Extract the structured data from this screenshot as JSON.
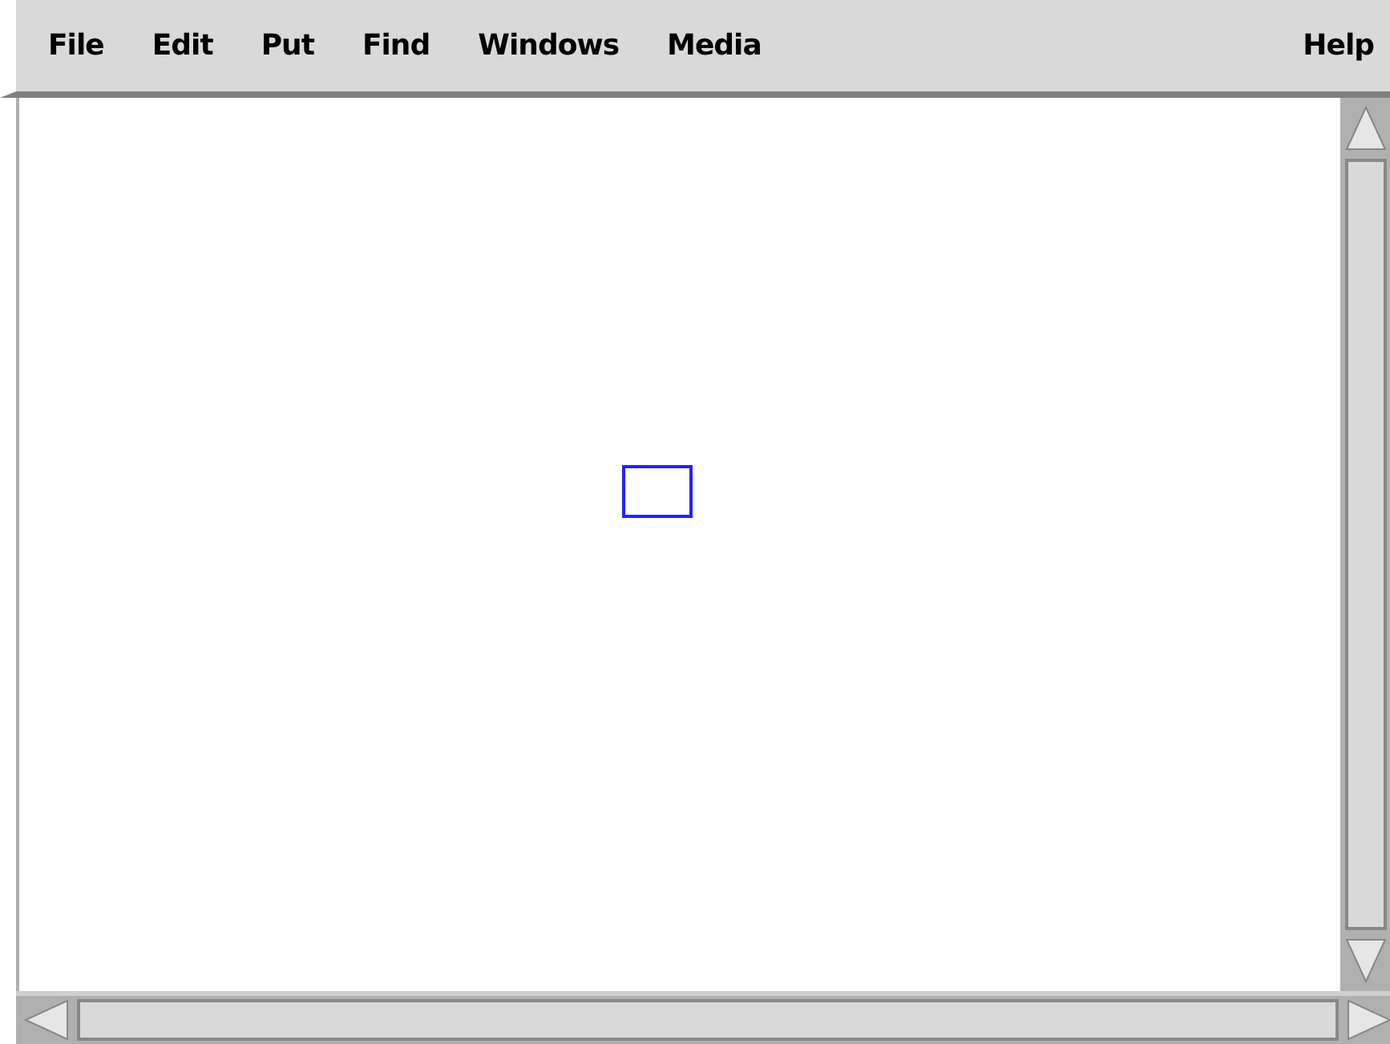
{
  "menu_bar": {
    "items": [
      {
        "label": "File"
      },
      {
        "label": "Edit"
      },
      {
        "label": "Put"
      },
      {
        "label": "Find"
      },
      {
        "label": "Windows"
      },
      {
        "label": "Media"
      }
    ],
    "help": "Help"
  },
  "canvas": {
    "shapes": [
      {
        "kind": "rectangle"
      }
    ]
  }
}
